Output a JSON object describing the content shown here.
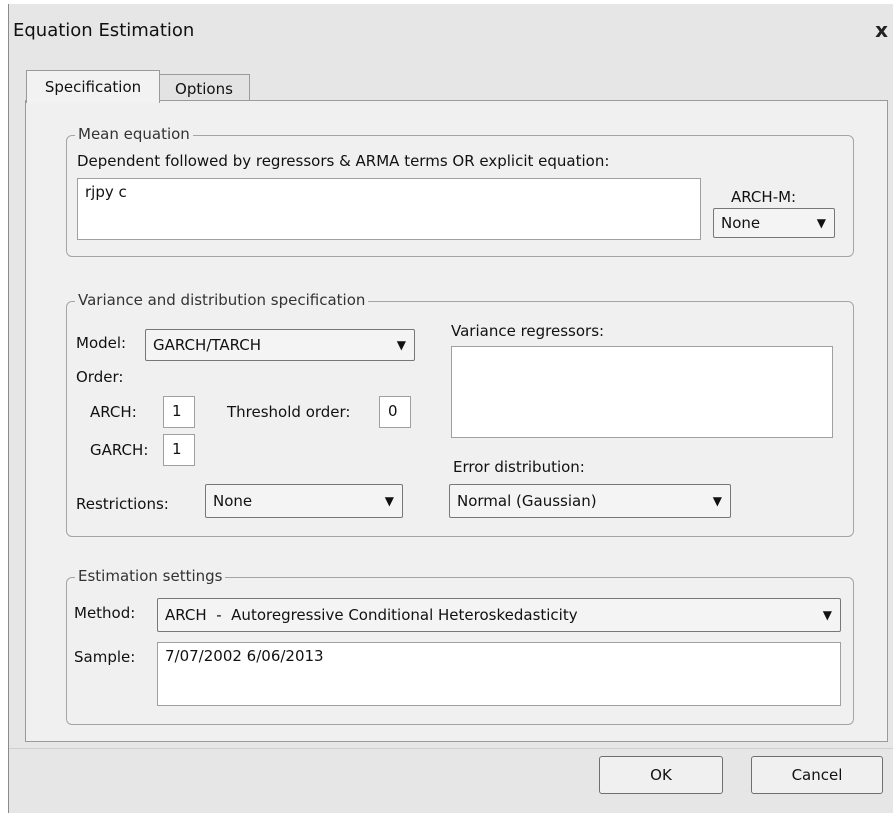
{
  "window": {
    "title": "Equation Estimation",
    "close_glyph": "x"
  },
  "tabs": [
    {
      "label": "Specification",
      "active": true
    },
    {
      "label": "Options",
      "active": false
    }
  ],
  "mean_equation": {
    "legend": "Mean equation",
    "prompt": "Dependent followed by regressors & ARMA terms OR explicit equation:",
    "equation_value": "rjpy c",
    "archm_label": "ARCH-M:",
    "archm_value": "None"
  },
  "variance": {
    "legend": "Variance and distribution specification",
    "model_label": "Model:",
    "model_value": "GARCH/TARCH",
    "order_label": "Order:",
    "arch_label": "ARCH:",
    "arch_value": "1",
    "threshold_label": "Threshold order:",
    "threshold_value": "0",
    "garch_label": "GARCH:",
    "garch_value": "1",
    "restrictions_label": "Restrictions:",
    "restrictions_value": "None",
    "variance_regressors_label": "Variance regressors:",
    "variance_regressors_value": "",
    "error_dist_label": "Error distribution:",
    "error_dist_value": "Normal (Gaussian)"
  },
  "estimation": {
    "legend": "Estimation settings",
    "method_label": "Method:",
    "method_value": "ARCH  -  Autoregressive Conditional Heteroskedasticity",
    "sample_label": "Sample:",
    "sample_value": "7/07/2002 6/06/2013"
  },
  "buttons": {
    "ok": "OK",
    "cancel": "Cancel"
  },
  "icons": {
    "dropdown": "chevron-down-icon",
    "close": "close-icon"
  }
}
